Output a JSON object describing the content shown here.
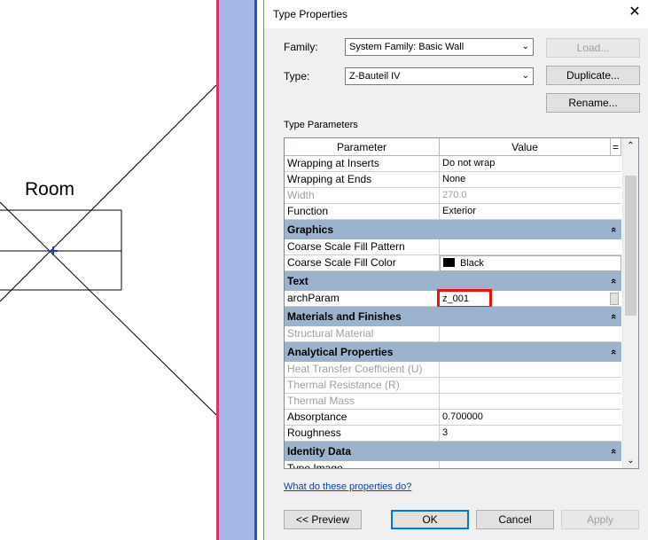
{
  "canvas": {
    "room_label": "Room"
  },
  "dialog": {
    "title": "Type Properties",
    "family_label": "Family:",
    "family_value": "System Family: Basic Wall",
    "type_label": "Type:",
    "type_value": "Z-Bauteil IV",
    "load_button": "Load...",
    "duplicate_button": "Duplicate...",
    "rename_button": "Rename...",
    "section_title": "Type Parameters",
    "columns": {
      "parameter": "Parameter",
      "value": "Value",
      "eq": "="
    },
    "rows": [
      {
        "kind": "row",
        "param": "Wrapping at Inserts",
        "value": "Do not wrap",
        "grey": false
      },
      {
        "kind": "row",
        "param": "Wrapping at Ends",
        "value": "None",
        "grey": false
      },
      {
        "kind": "row",
        "param": "Width",
        "value": "270.0",
        "grey": true
      },
      {
        "kind": "row",
        "param": "Function",
        "value": "Exterior",
        "grey": false
      },
      {
        "kind": "group",
        "label": "Graphics"
      },
      {
        "kind": "row",
        "param": "Coarse Scale Fill Pattern",
        "value": "",
        "grey": false
      },
      {
        "kind": "row",
        "param": "Coarse Scale Fill Color",
        "value": "Black",
        "grey": false,
        "swatch": true
      },
      {
        "kind": "group",
        "label": "Text"
      },
      {
        "kind": "row",
        "param": "archParam",
        "value": "z_001",
        "grey": false,
        "editing": true
      },
      {
        "kind": "group",
        "label": "Materials and Finishes"
      },
      {
        "kind": "row",
        "param": "Structural Material",
        "value": "",
        "grey": true
      },
      {
        "kind": "group",
        "label": "Analytical Properties"
      },
      {
        "kind": "row",
        "param": "Heat Transfer Coefficient (U)",
        "value": "",
        "grey": true
      },
      {
        "kind": "row",
        "param": "Thermal Resistance (R)",
        "value": "",
        "grey": true
      },
      {
        "kind": "row",
        "param": "Thermal Mass",
        "value": "",
        "grey": true
      },
      {
        "kind": "row",
        "param": "Absorptance",
        "value": "0.700000",
        "grey": false
      },
      {
        "kind": "row",
        "param": "Roughness",
        "value": "3",
        "grey": false
      },
      {
        "kind": "group",
        "label": "Identity Data"
      },
      {
        "kind": "row",
        "param": "Type Image",
        "value": "",
        "grey": false
      }
    ],
    "help_link": "What do these properties do?",
    "preview_button": "<< Preview",
    "ok_button": "OK",
    "cancel_button": "Cancel",
    "apply_button": "Apply",
    "collapse_glyph": "«"
  }
}
